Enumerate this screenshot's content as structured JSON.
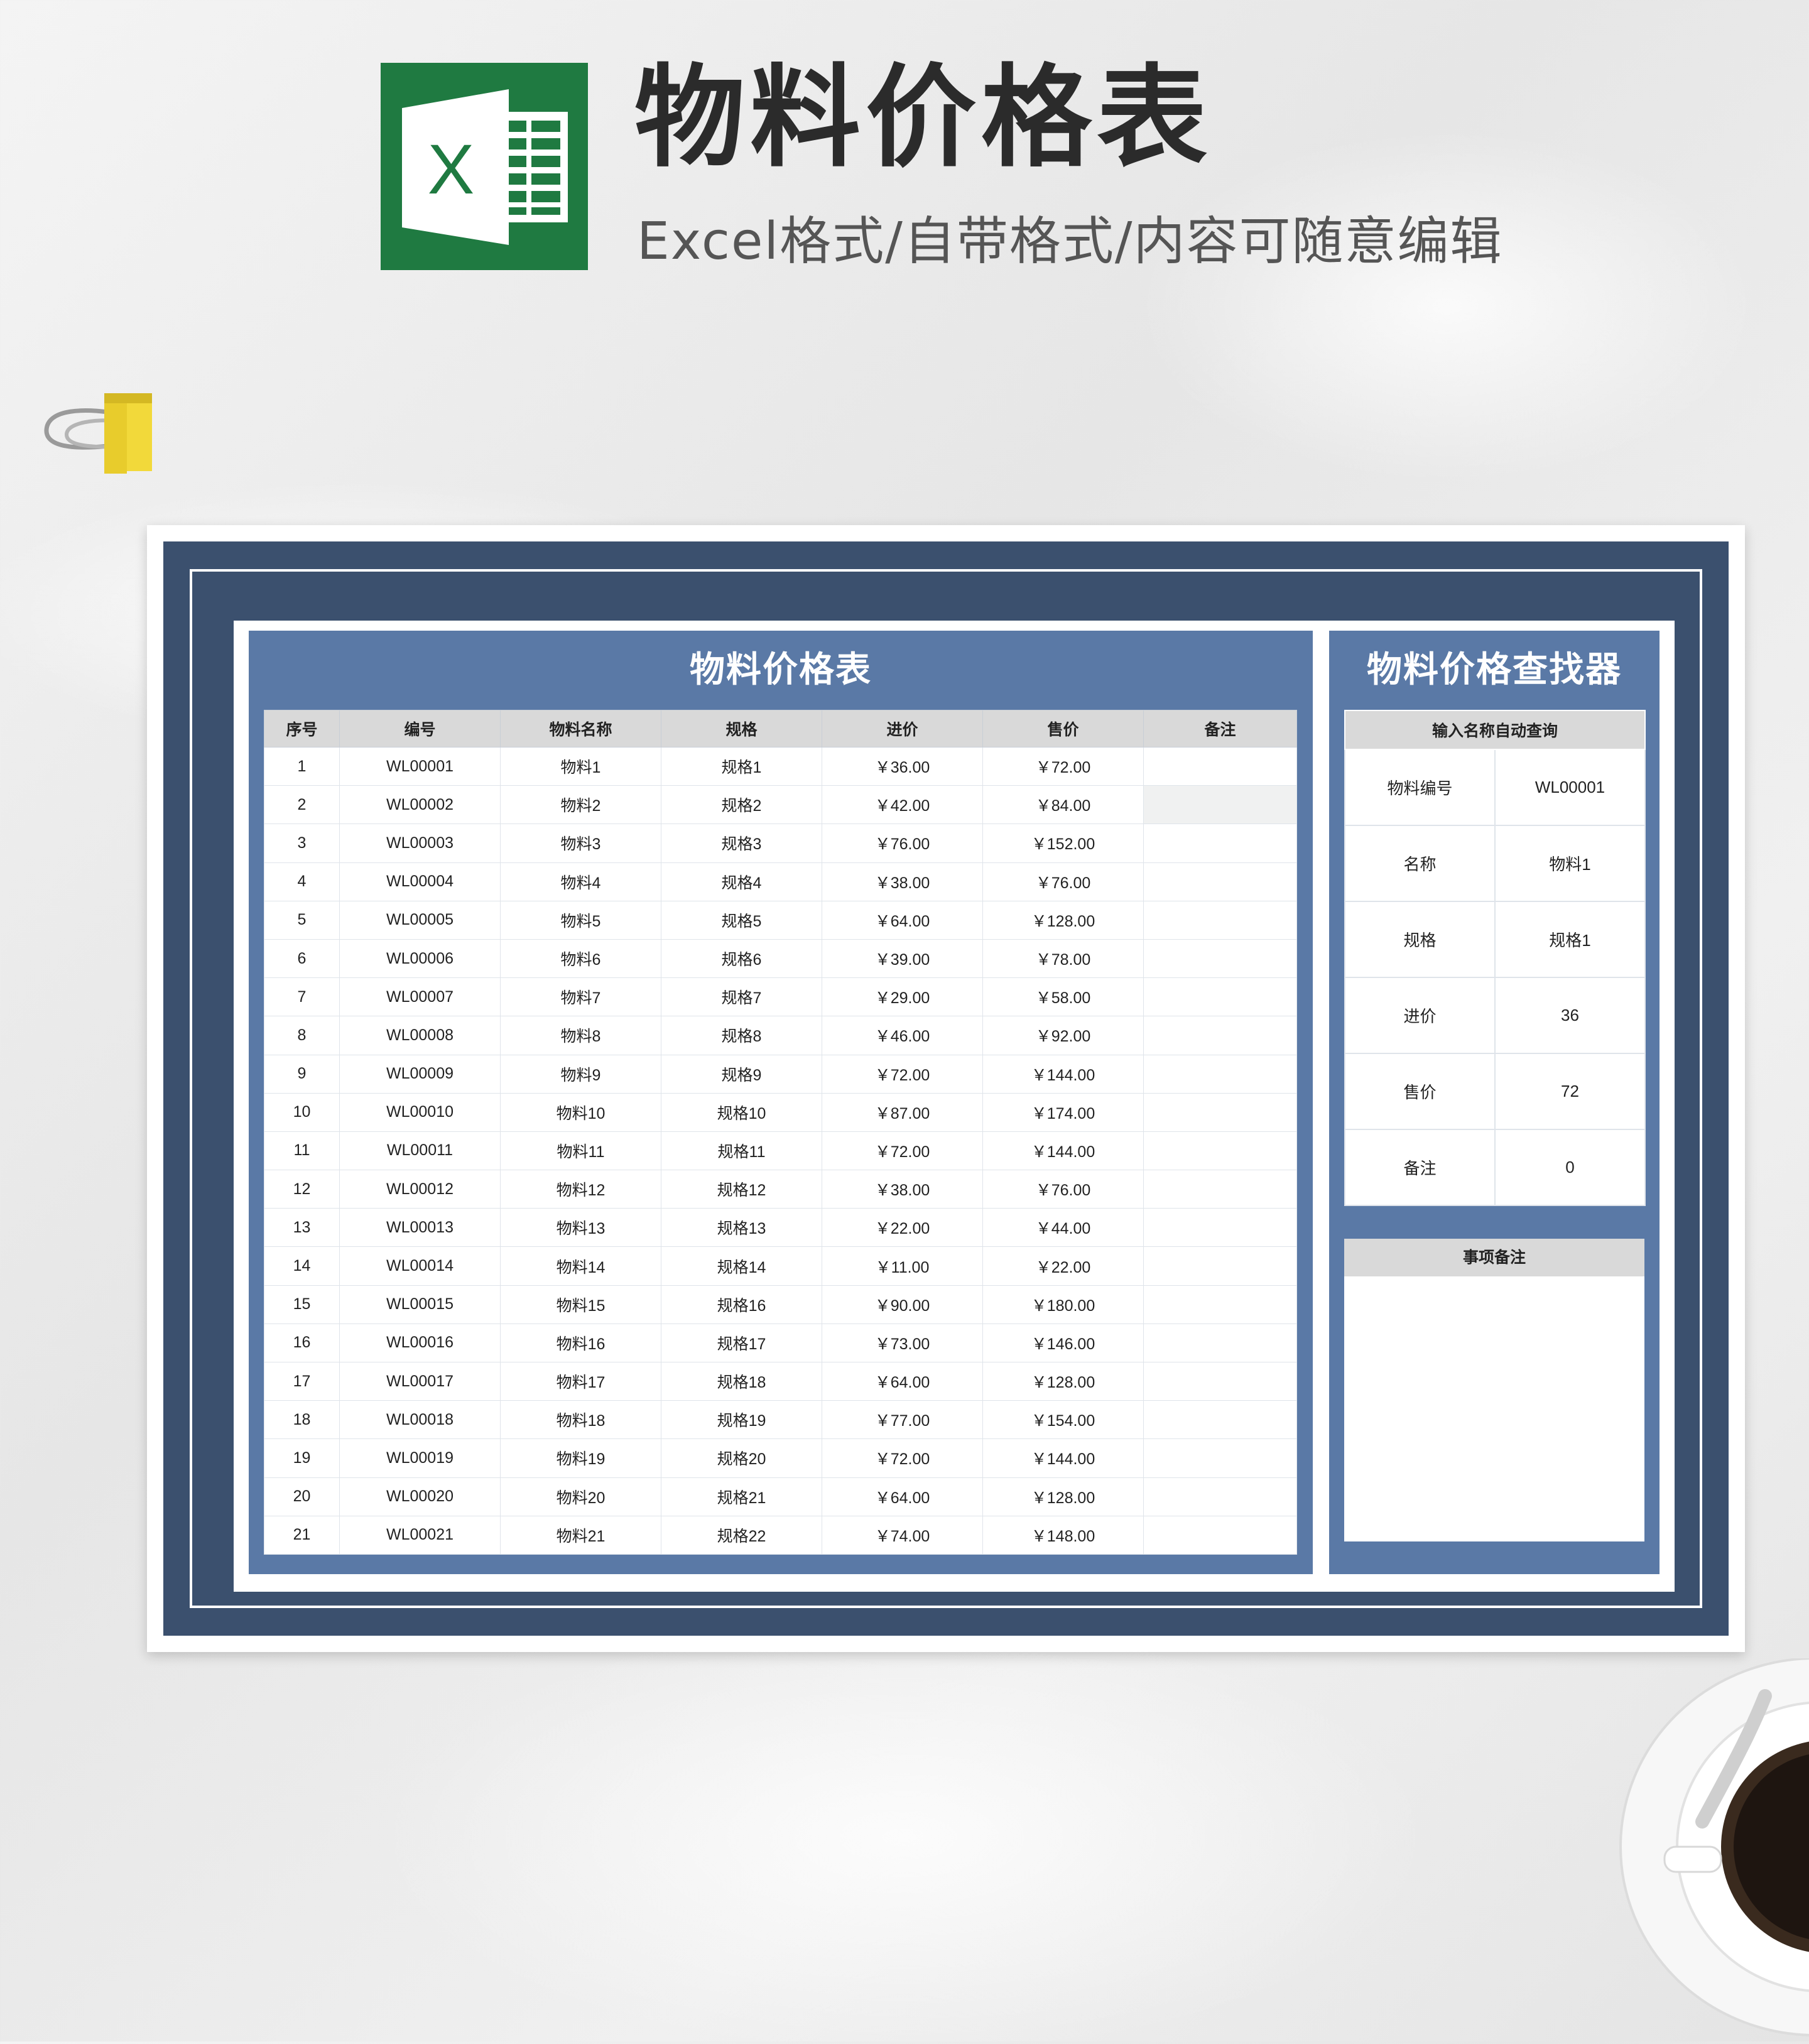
{
  "header": {
    "logo_letter": "X",
    "title": "物料价格表",
    "subtitle": "Excel格式/自带格式/内容可随意编辑"
  },
  "colors": {
    "frame": "#3b506e",
    "panel": "#5a79a6",
    "header_gray": "#d9d9d9",
    "logo_green": "#1f7a41"
  },
  "main_table": {
    "title": "物料价格表",
    "columns": [
      "序号",
      "编号",
      "物料名称",
      "规格",
      "进价",
      "售价",
      "备注"
    ],
    "rows": [
      [
        "1",
        "WL00001",
        "物料1",
        "规格1",
        "￥36.00",
        "￥72.00",
        ""
      ],
      [
        "2",
        "WL00002",
        "物料2",
        "规格2",
        "￥42.00",
        "￥84.00",
        ""
      ],
      [
        "3",
        "WL00003",
        "物料3",
        "规格3",
        "￥76.00",
        "￥152.00",
        ""
      ],
      [
        "4",
        "WL00004",
        "物料4",
        "规格4",
        "￥38.00",
        "￥76.00",
        ""
      ],
      [
        "5",
        "WL00005",
        "物料5",
        "规格5",
        "￥64.00",
        "￥128.00",
        ""
      ],
      [
        "6",
        "WL00006",
        "物料6",
        "规格6",
        "￥39.00",
        "￥78.00",
        ""
      ],
      [
        "7",
        "WL00007",
        "物料7",
        "规格7",
        "￥29.00",
        "￥58.00",
        ""
      ],
      [
        "8",
        "WL00008",
        "物料8",
        "规格8",
        "￥46.00",
        "￥92.00",
        ""
      ],
      [
        "9",
        "WL00009",
        "物料9",
        "规格9",
        "￥72.00",
        "￥144.00",
        ""
      ],
      [
        "10",
        "WL00010",
        "物料10",
        "规格10",
        "￥87.00",
        "￥174.00",
        ""
      ],
      [
        "11",
        "WL00011",
        "物料11",
        "规格11",
        "￥72.00",
        "￥144.00",
        ""
      ],
      [
        "12",
        "WL00012",
        "物料12",
        "规格12",
        "￥38.00",
        "￥76.00",
        ""
      ],
      [
        "13",
        "WL00013",
        "物料13",
        "规格13",
        "￥22.00",
        "￥44.00",
        ""
      ],
      [
        "14",
        "WL00014",
        "物料14",
        "规格14",
        "￥11.00",
        "￥22.00",
        ""
      ],
      [
        "15",
        "WL00015",
        "物料15",
        "规格16",
        "￥90.00",
        "￥180.00",
        ""
      ],
      [
        "16",
        "WL00016",
        "物料16",
        "规格17",
        "￥73.00",
        "￥146.00",
        ""
      ],
      [
        "17",
        "WL00017",
        "物料17",
        "规格18",
        "￥64.00",
        "￥128.00",
        ""
      ],
      [
        "18",
        "WL00018",
        "物料18",
        "规格19",
        "￥77.00",
        "￥154.00",
        ""
      ],
      [
        "19",
        "WL00019",
        "物料19",
        "规格20",
        "￥72.00",
        "￥144.00",
        ""
      ],
      [
        "20",
        "WL00020",
        "物料20",
        "规格21",
        "￥64.00",
        "￥128.00",
        ""
      ],
      [
        "21",
        "WL00021",
        "物料21",
        "规格22",
        "￥74.00",
        "￥148.00",
        ""
      ]
    ]
  },
  "lookup": {
    "title": "物料价格查找器",
    "header": "输入名称自动查询",
    "rows": [
      {
        "label": "物料编号",
        "value": "WL00001"
      },
      {
        "label": "名称",
        "value": "物料1"
      },
      {
        "label": "规格",
        "value": "规格1"
      },
      {
        "label": "进价",
        "value": "36"
      },
      {
        "label": "售价",
        "value": "72"
      },
      {
        "label": "备注",
        "value": "0"
      }
    ],
    "notes_header": "事项备注"
  }
}
